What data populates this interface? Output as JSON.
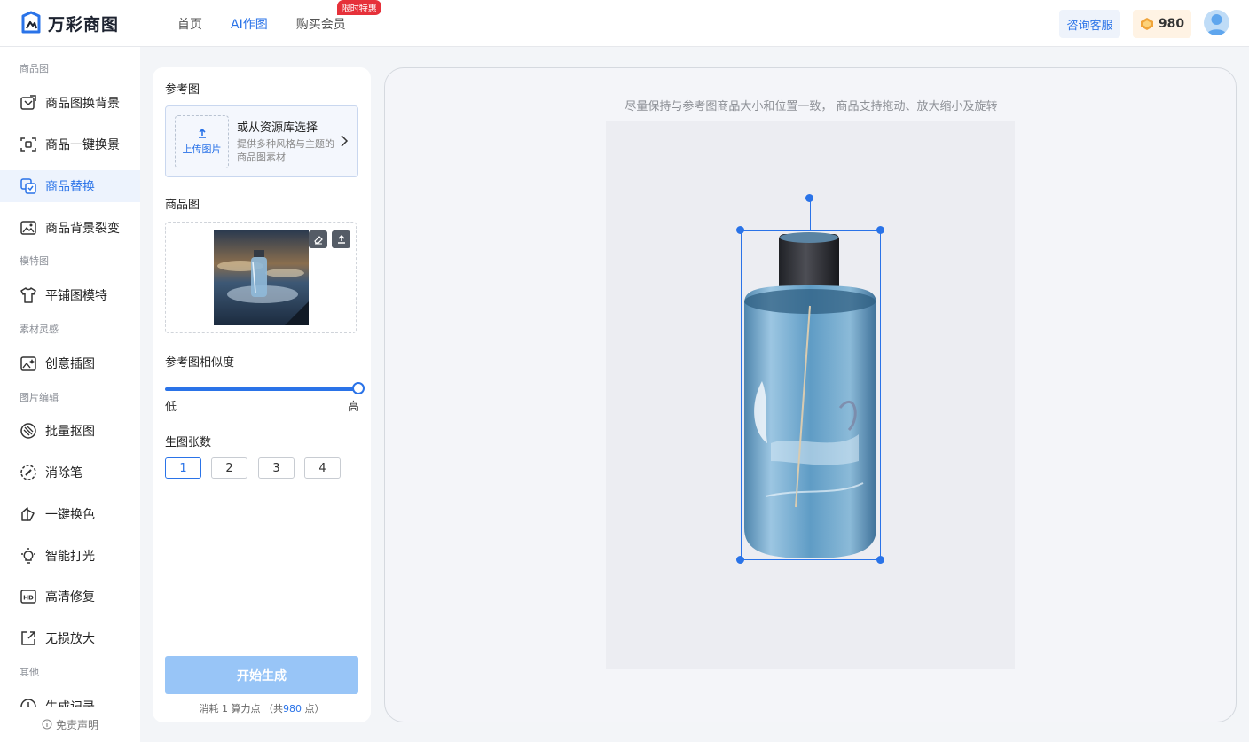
{
  "header": {
    "brand": "万彩商图",
    "nav": [
      {
        "label": "首页",
        "active": false
      },
      {
        "label": "AI作图",
        "active": true
      },
      {
        "label": "购买会员",
        "active": false,
        "badge": "限时特惠"
      }
    ],
    "consult_label": "咨询客服",
    "points": "980",
    "accent_color": "#2a73e8"
  },
  "sidebar": {
    "sections": [
      {
        "title": "商品图",
        "items": [
          {
            "label": "商品图换背景",
            "icon": "image-swap-icon"
          },
          {
            "label": "商品一键换景",
            "icon": "scene-swap-icon"
          },
          {
            "label": "商品替换",
            "icon": "product-replace-icon",
            "active": true
          },
          {
            "label": "商品背景裂变",
            "icon": "background-split-icon"
          }
        ]
      },
      {
        "title": "模特图",
        "items": [
          {
            "label": "平铺图模特",
            "icon": "shirt-icon"
          }
        ]
      },
      {
        "title": "素材灵感",
        "items": [
          {
            "label": "创意插图",
            "icon": "creative-image-icon"
          }
        ]
      },
      {
        "title": "图片编辑",
        "items": [
          {
            "label": "批量抠图",
            "icon": "cutout-icon"
          },
          {
            "label": "消除笔",
            "icon": "eraser-pen-icon"
          },
          {
            "label": "一键换色",
            "icon": "recolor-icon"
          },
          {
            "label": "智能打光",
            "icon": "bulb-icon"
          },
          {
            "label": "高清修复",
            "icon": "hd-icon"
          },
          {
            "label": "无损放大",
            "icon": "enlarge-icon"
          }
        ]
      },
      {
        "title": "其他",
        "items": [
          {
            "label": "生成记录",
            "icon": "history-icon"
          }
        ]
      }
    ],
    "disclaimer": "免责声明"
  },
  "panel": {
    "reference_label": "参考图",
    "upload_label": "上传图片",
    "library_title": "或从资源库选择",
    "library_desc": "提供多种风格与主题的商品图素材",
    "product_label": "商品图",
    "similarity_label": "参考图相似度",
    "similarity_value": 1.0,
    "similarity_low": "低",
    "similarity_high": "高",
    "count_label": "生图张数",
    "counts": [
      "1",
      "2",
      "3",
      "4"
    ],
    "selected_count": "1",
    "generate_label": "开始生成",
    "cost_prefix": "消耗 1 算力点 （共",
    "cost_total": "980",
    "cost_suffix": " 点）"
  },
  "canvas": {
    "tip": "尽量保持与参考图商品大小和位置一致， 商品支持拖动、放大缩小及旋转"
  }
}
